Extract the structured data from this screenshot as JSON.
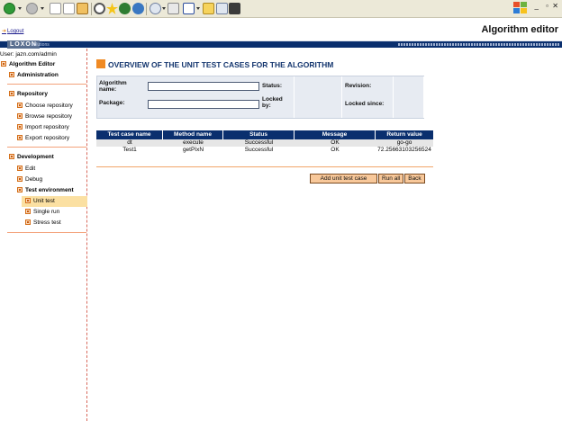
{
  "app": {
    "title": "Algorithm editor",
    "logout": "Logout",
    "brand": "LOXON",
    "brand_sub": "solutions"
  },
  "sidebar": {
    "user": "User: jazn.com/admin",
    "root": "Algorithm Editor",
    "administration": "Administration",
    "repository": {
      "label": "Repository",
      "items": [
        "Choose repository",
        "Browse repository",
        "Import repository",
        "Export repository"
      ]
    },
    "development": {
      "label": "Development",
      "items": [
        "Edit",
        "Debug"
      ],
      "test_env": {
        "label": "Test environment",
        "items": [
          "Unit test",
          "Single run",
          "Stress test"
        ],
        "active": "Unit test"
      }
    }
  },
  "main": {
    "heading": "OVERVIEW OF THE UNIT TEST CASES FOR THE ALGORITHM",
    "form": {
      "algorithm_name_label": "Algorithm name:",
      "algorithm_name_value": "",
      "package_label": "Package:",
      "package_value": "",
      "status_label": "Status:",
      "status_value": "",
      "locked_by_label": "Locked by:",
      "locked_by_value": "",
      "revision_label": "Revision:",
      "revision_value": "",
      "locked_since_label": "Locked since:",
      "locked_since_value": ""
    },
    "table": {
      "headers": [
        "Test case name",
        "Method name",
        "Status",
        "Message",
        "Return value"
      ],
      "rows": [
        [
          "dt",
          "execute",
          "Successful",
          "OK",
          "go-go"
        ],
        [
          "Test1",
          "getPIxN",
          "Successful",
          "OK",
          "72.25663103256524"
        ]
      ]
    },
    "buttons": {
      "add": "Add unit test case",
      "run_all": "Run all",
      "back": "Back"
    }
  },
  "colors": {
    "navy": "#0a2f6e",
    "accent_orange": "#f08a24",
    "active_bg": "#fbe0a2",
    "form_bg": "#e7ebf2"
  }
}
